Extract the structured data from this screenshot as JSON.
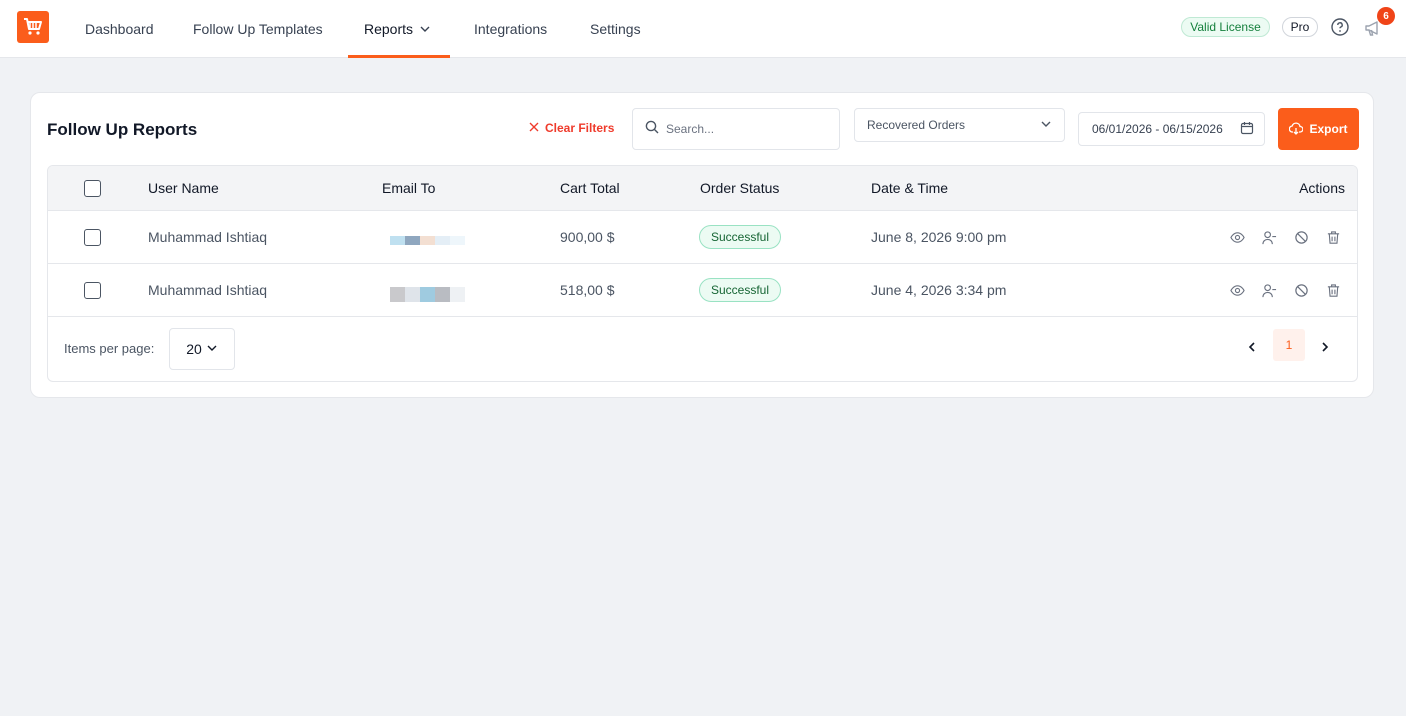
{
  "nav": {
    "items": [
      {
        "label": "Dashboard"
      },
      {
        "label": "Follow Up Templates"
      },
      {
        "label": "Reports"
      },
      {
        "label": "Integrations"
      },
      {
        "label": "Settings"
      }
    ],
    "license_badge": "Valid License",
    "plan_badge": "Pro",
    "notification_count": "6",
    "accent_color": "#fb5d1b"
  },
  "page": {
    "title": "Follow Up Reports",
    "clear_filters_label": "Clear Filters",
    "search_placeholder": "Search...",
    "filter_selected": "Recovered Orders",
    "date_range": "06/01/2026 - 06/15/2026",
    "export_label": "Export"
  },
  "table": {
    "columns": [
      "User Name",
      "Email To",
      "Cart Total",
      "Order Status",
      "Date & Time",
      "Actions"
    ],
    "rows": [
      {
        "user_name": "Muhammad Ishtiaq",
        "cart_total": "900,00 $",
        "order_status": "Successful",
        "date_time": "June 8, 2026 9:00 pm"
      },
      {
        "user_name": "Muhammad Ishtiaq",
        "cart_total": "518,00 $",
        "order_status": "Successful",
        "date_time": "June 4, 2026 3:34 pm"
      }
    ]
  },
  "pagination": {
    "items_per_page_label": "Items per page:",
    "items_per_page_value": "20",
    "current_page": "1"
  }
}
